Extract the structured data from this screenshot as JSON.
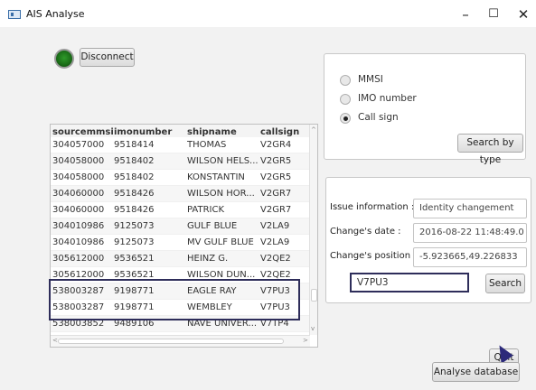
{
  "window": {
    "title": "AIS Analyse",
    "minimize": "–",
    "maximize": "☐",
    "close": "✕"
  },
  "connection": {
    "disconnect_label": "Disconnect",
    "status_color": "#1f7a1c"
  },
  "table": {
    "columns": [
      "sourcemmsi",
      "imonumber",
      "shipname",
      "callsign"
    ],
    "rows": [
      [
        "304057000",
        "9518414",
        "THOMAS",
        "V2GR4"
      ],
      [
        "304058000",
        "9518402",
        "WILSON HELS...",
        "V2GR5"
      ],
      [
        "304058000",
        "9518402",
        "KONSTANTIN",
        "V2GR5"
      ],
      [
        "304060000",
        "9518426",
        "WILSON HOR...",
        "V2GR7"
      ],
      [
        "304060000",
        "9518426",
        "PATRICK",
        "V2GR7"
      ],
      [
        "304010986",
        "9125073",
        "GULF BLUE",
        "V2LA9"
      ],
      [
        "304010986",
        "9125073",
        "MV GULF BLUE",
        "V2LA9"
      ],
      [
        "305612000",
        "9536521",
        "HEINZ G.",
        "V2QE2"
      ],
      [
        "305612000",
        "9536521",
        "WILSON DUN...",
        "V2QE2"
      ],
      [
        "538003287",
        "9198771",
        "EAGLE RAY",
        "V7PU3"
      ],
      [
        "538003287",
        "9198771",
        "WEMBLEY",
        "V7PU3"
      ],
      [
        "538003852",
        "9489106",
        "NAVE UNIVER...",
        "V7TP4"
      ]
    ]
  },
  "search_type": {
    "options": [
      "MMSI",
      "IMO number",
      "Call sign"
    ],
    "selected": "Call sign",
    "button_label": "Search by type"
  },
  "info": {
    "issue_label": "Issue information :",
    "issue_value": "Identity changement",
    "date_label": "Change's date :",
    "date_value": "2016-08-22 11:48:49.0",
    "position_label": "Change's position :",
    "position_value": "-5.923665,49.226833",
    "callsign_value": "V7PU3",
    "search_label": "Search"
  },
  "actions": {
    "quit_label": "Quit",
    "analyse_label": "Analyse database"
  },
  "colors": {
    "highlight_border": "#2e2d5a",
    "cursor": "#2c2a7a"
  }
}
